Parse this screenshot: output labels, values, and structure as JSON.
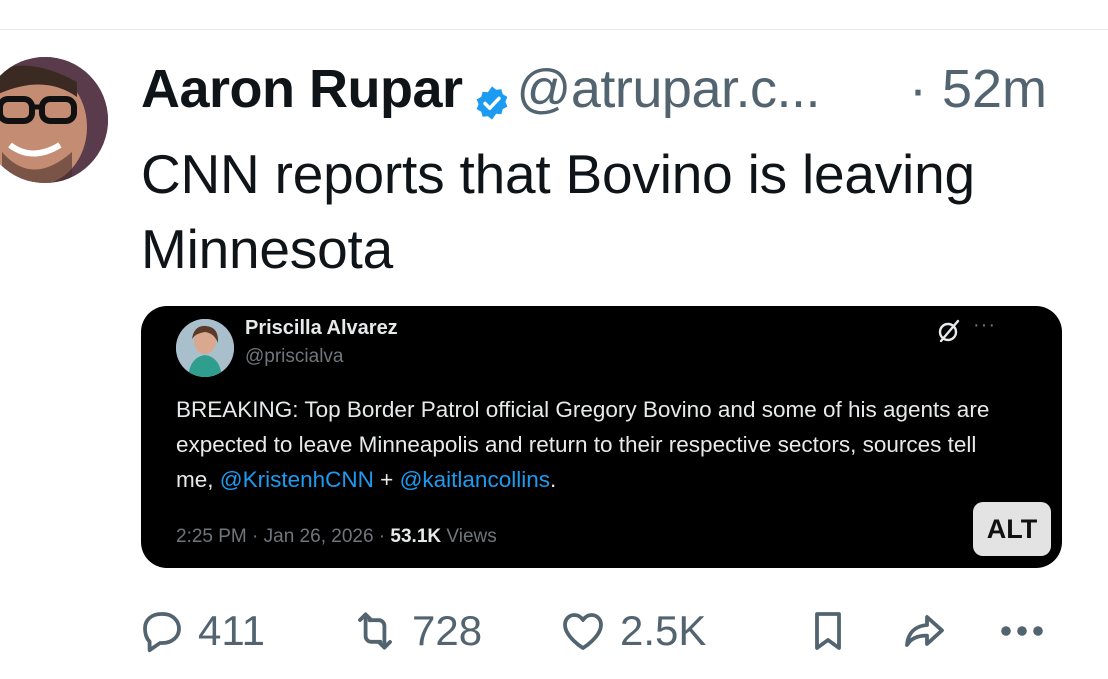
{
  "post": {
    "display_name": "Aaron Rupar",
    "handle": "@atrupar.c...",
    "time": "· 52m",
    "text": "CNN reports that Bovino is leaving Minnesota"
  },
  "quoted": {
    "name": "Priscilla Alvarez",
    "handle": "@priscialva",
    "text_start": "BREAKING: Top Border Patrol official Gregory Bovino and some of his agents are expected to leave Minneapolis and return to their respective sectors, sources tell me, ",
    "mention_1": "@KristenhCNN",
    "plus": " + ",
    "mention_2": "@kaitlancollins",
    "period": ".",
    "meta_time": "2:25 PM · Jan 26, 2026 · ",
    "views_count": "53.1K",
    "views_label": " Views",
    "more": "···",
    "alt": "ALT"
  },
  "actions": {
    "replies": "411",
    "reposts": "728",
    "likes": "2.5K"
  },
  "colors": {
    "text": "#0f1419",
    "secondary": "#536471",
    "verified": "#1d9bf0",
    "card_bg": "#000000",
    "link": "#1d9bf0"
  },
  "icons": [
    "verified-badge-icon",
    "grok-icon",
    "more-icon",
    "reply-icon",
    "repost-icon",
    "like-icon",
    "bookmark-icon",
    "share-icon"
  ]
}
